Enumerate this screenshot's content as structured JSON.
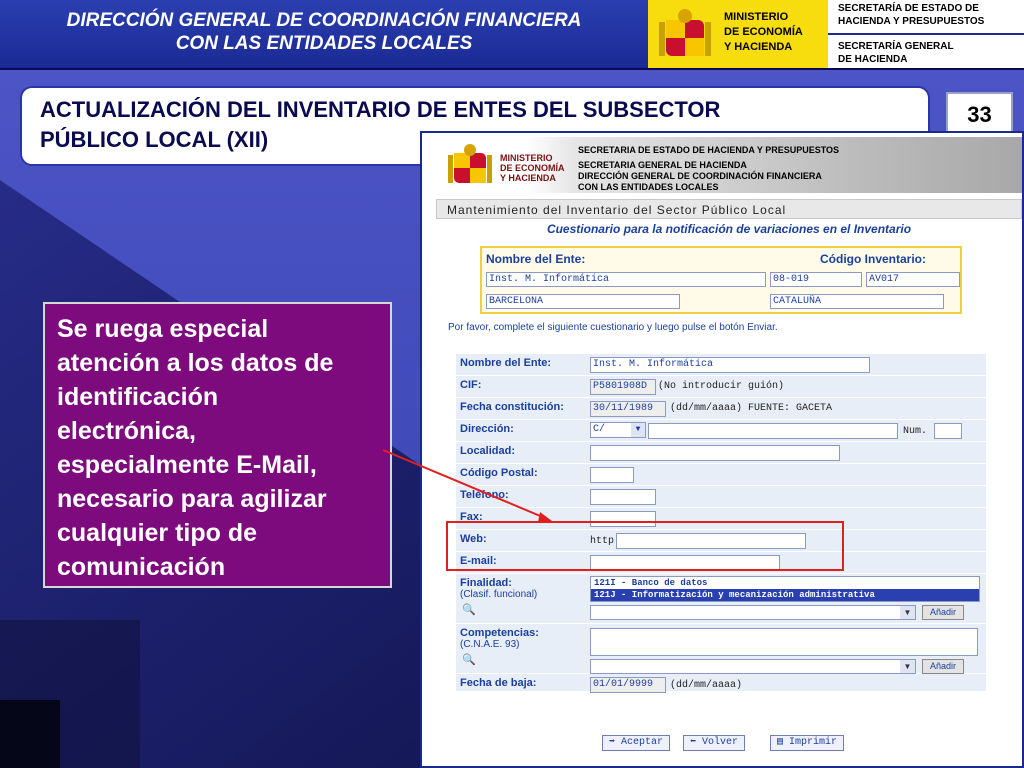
{
  "header": {
    "left_title_line1": "DIRECCIÓN GENERAL DE COORDINACIÓN FINANCIERA",
    "left_title_line2": "CON LAS ENTIDADES LOCALES",
    "ministry_line1": "MINISTERIO",
    "ministry_line2": "DE ECONOMÍA",
    "ministry_line3": "Y HACIENDA",
    "sec1_line1": "SECRETARÍA DE ESTADO DE",
    "sec1_line2": "HACIENDA Y PRESUPUESTOS",
    "sec2_line1": "SECRETARÍA GENERAL",
    "sec2_line2": "DE HACIENDA"
  },
  "slide": {
    "title_line1": "ACTUALIZACIÓN DEL INVENTARIO DE ENTES DEL SUBSECTOR",
    "title_line2": "PÚBLICO LOCAL (XII)",
    "page_number": "33",
    "note_lines": [
      "Se ruega especial",
      "atención a los datos de",
      "identificación",
      "electrónica,",
      "especialmente E-Mail,",
      "necesario para agilizar",
      "cualquier tipo de",
      "comunicación"
    ]
  },
  "app": {
    "ministry_line1": "MINISTERIO",
    "ministry_line2": "DE ECONOMÍA",
    "ministry_line3": "Y HACIENDA",
    "org_line1": "SECRETARIA DE ESTADO DE HACIENDA Y PRESUPUESTOS",
    "org_line2": "SECRETARIA GENERAL DE HACIENDA",
    "org_line3": "DIRECCIÓN GENERAL DE COORDINACIÓN FINANCIERA",
    "org_line4": "CON LAS ENTIDADES LOCALES",
    "maint_title": "Mantenimiento del Inventario del Sector Público Local",
    "questionnaire_title": "Cuestionario para la notificación de variaciones en el Inventario",
    "ident": {
      "name_label": "Nombre del Ente:",
      "code_label": "Código Inventario:",
      "name_value": "Inst. M. Informática",
      "code1": "08-019",
      "code2": "AV017",
      "province": "BARCELONA",
      "community": "CATALUÑA"
    },
    "instructions": "Por favor, complete el siguiente cuestionario y luego pulse el botón Enviar.",
    "form": {
      "nombre_label": "Nombre del Ente:",
      "nombre_value": "Inst. M. Informática",
      "cif_label": "CIF:",
      "cif_value": "P5801908D",
      "cif_hint": "(No introducir guión)",
      "fecha_label": "Fecha constitución:",
      "fecha_value": "30/11/1989",
      "fecha_hint": "(dd/mm/aaaa) FUENTE: GACETA",
      "direccion_label": "Dirección:",
      "direccion_select": "C/",
      "num_label": "Num.",
      "localidad_label": "Localidad:",
      "cp_label": "Código Postal:",
      "telefono_label": "Teléfono:",
      "fax_label": "Fax:",
      "web_label": "Web:",
      "web_prefix": "http:",
      "email_label": "E-mail:",
      "finalidad_label": "Finalidad:",
      "finalidad_sub": "(Clasif. funcional)",
      "finalidad_opt1": "121I - Banco de datos",
      "finalidad_opt2": "121J - Informatización y mecanización administrativa",
      "add_label": "Añadir",
      "competencias_label": "Competencias:",
      "competencias_sub": "(C.N.A.E. 93)",
      "baja_label": "Fecha de baja:",
      "baja_value": "01/01/9999",
      "baja_hint": "(dd/mm/aaaa)"
    },
    "buttons": {
      "accept": "Aceptar",
      "back": "Volver",
      "print": "Imprimir"
    }
  }
}
